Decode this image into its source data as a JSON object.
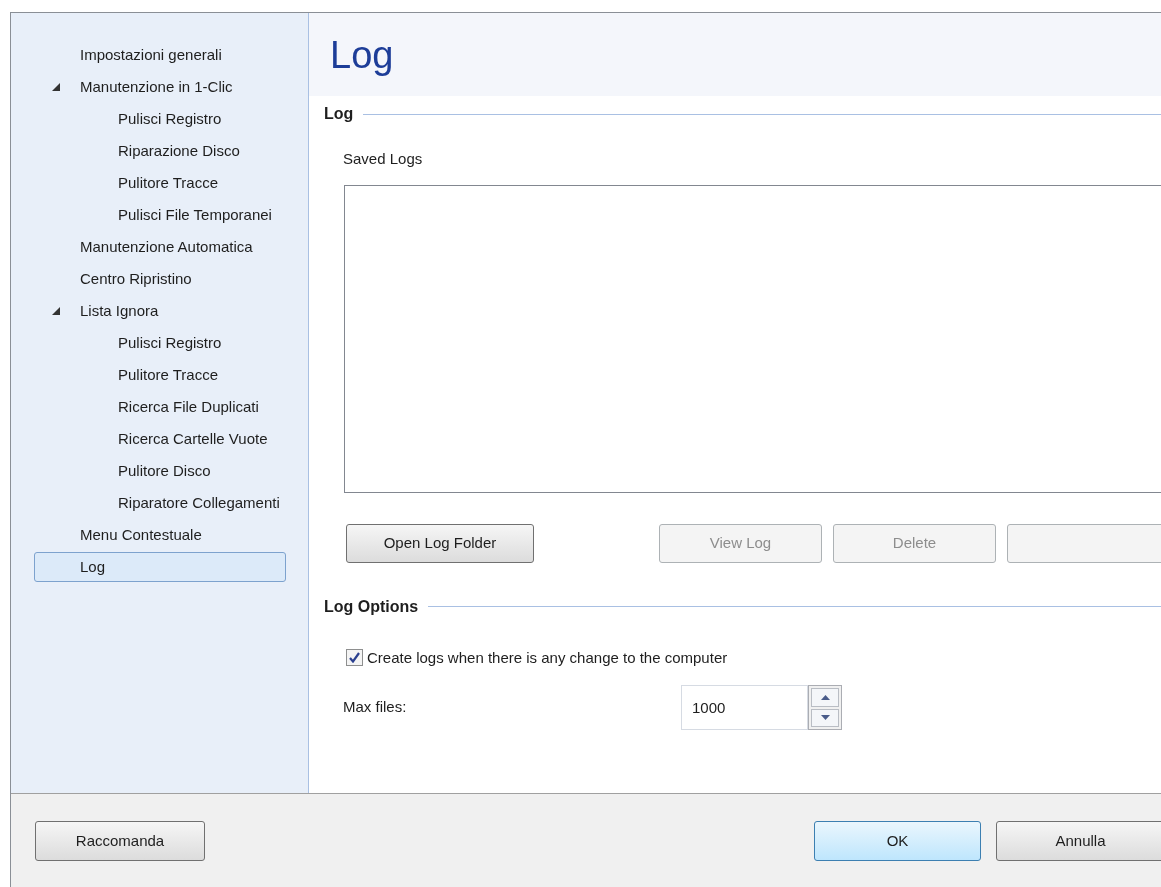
{
  "sidebar": {
    "items": [
      {
        "label": "Impostazioni generali",
        "selected": false
      },
      {
        "label": "Manutenzione in 1-Clic",
        "selected": false,
        "expanded": true,
        "children": [
          {
            "label": "Pulisci Registro",
            "selected": false
          },
          {
            "label": "Riparazione Disco",
            "selected": false
          },
          {
            "label": "Pulitore Tracce",
            "selected": false
          },
          {
            "label": "Pulisci File Temporanei",
            "selected": false
          }
        ]
      },
      {
        "label": "Manutenzione Automatica",
        "selected": false
      },
      {
        "label": "Centro Ripristino",
        "selected": false
      },
      {
        "label": "Lista Ignora",
        "selected": false,
        "expanded": true,
        "children": [
          {
            "label": "Pulisci Registro",
            "selected": false
          },
          {
            "label": "Pulitore Tracce",
            "selected": false
          },
          {
            "label": "Ricerca File Duplicati",
            "selected": false
          },
          {
            "label": "Ricerca Cartelle Vuote",
            "selected": false
          },
          {
            "label": "Pulitore Disco",
            "selected": false
          },
          {
            "label": "Riparatore Collegamenti",
            "selected": false
          }
        ]
      },
      {
        "label": "Menu Contestuale",
        "selected": false
      },
      {
        "label": "Log",
        "selected": true
      }
    ]
  },
  "page_title": "Log",
  "log_group": {
    "title": "Log",
    "saved_logs_label": "Saved Logs",
    "buttons": [
      {
        "label": "Open Log Folder",
        "disabled": false
      },
      {
        "label": "View Log",
        "disabled": true
      },
      {
        "label": "Delete",
        "disabled": true
      },
      {
        "disabled": true
      }
    ]
  },
  "options_group": {
    "title": "Log Options",
    "create_logs": {
      "label": "Create logs when there is any change to the computer",
      "checked": true
    },
    "max_files": {
      "label": "Max files:",
      "value": "1000"
    }
  },
  "footer": {
    "recommend_button": "Raccomanda",
    "ok_button": "OK",
    "cancel_button": "Annulla"
  }
}
